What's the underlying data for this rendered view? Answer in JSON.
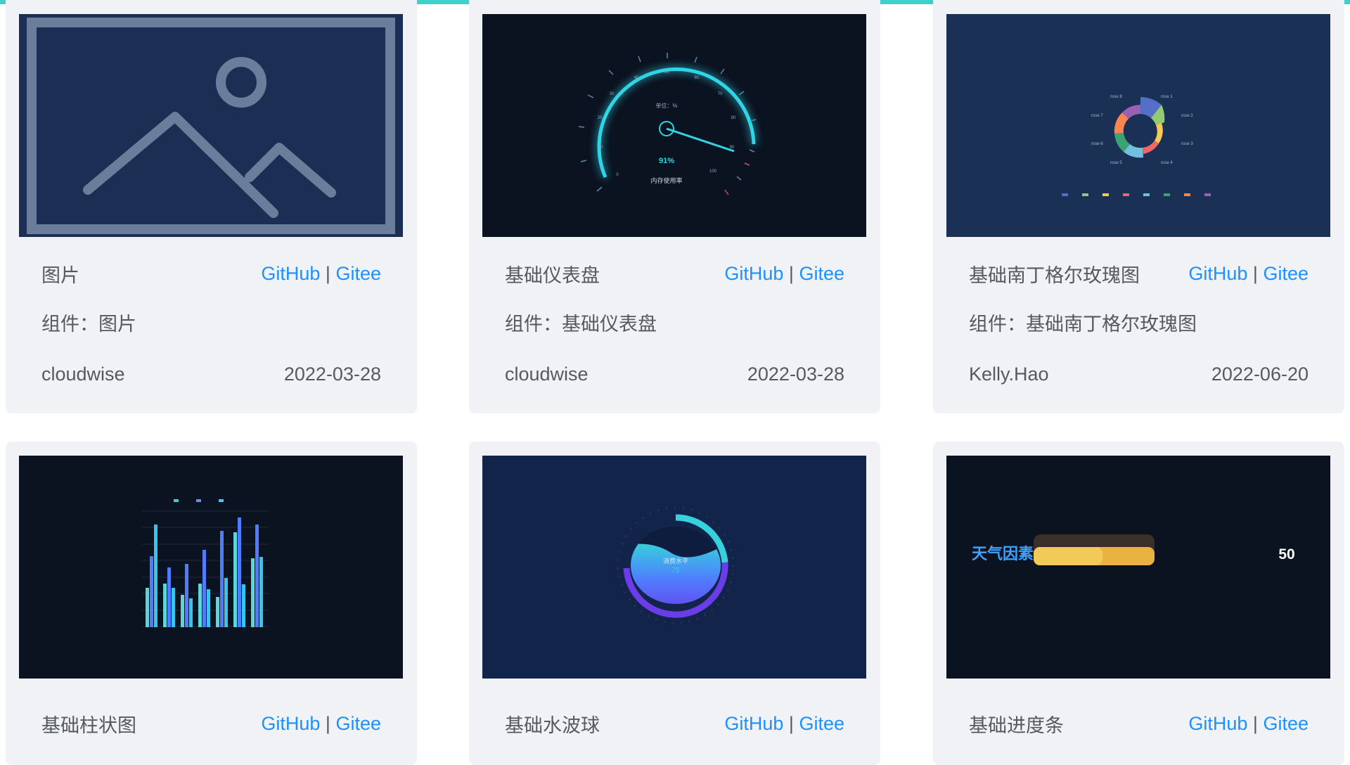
{
  "colors": {
    "accent_bar": "#3fd0c9",
    "link": "#1e90ff",
    "card_bg": "#f0f2f5",
    "text": "#555a60"
  },
  "cards": [
    {
      "title": "图片",
      "github": "GitHub",
      "sep": "|",
      "gitee": "Gitee",
      "component": "组件：图片",
      "author": "cloudwise",
      "date": "2022-03-28",
      "thumb_icon": "image-placeholder-icon"
    },
    {
      "title": "基础仪表盘",
      "github": "GitHub",
      "sep": "|",
      "gitee": "Gitee",
      "component": "组件：基础仪表盘",
      "author": "cloudwise",
      "date": "2022-03-28",
      "thumb": {
        "unit": "单位：%",
        "value": "91%",
        "label": "内存使用率",
        "ticks": [
          "0",
          "10",
          "20",
          "30",
          "40",
          "50",
          "60",
          "70",
          "80",
          "90",
          "100"
        ]
      }
    },
    {
      "title": "基础南丁格尔玫瑰图",
      "github": "GitHub",
      "sep": "|",
      "gitee": "Gitee",
      "component": "组件：基础南丁格尔玫瑰图",
      "author": "Kelly.Hao",
      "date": "2022-06-20",
      "thumb": {
        "labels": [
          "rose 1",
          "rose 2",
          "rose 3",
          "rose 4",
          "rose 5",
          "rose 6",
          "rose 7",
          "rose 8"
        ]
      }
    },
    {
      "title": "基础柱状图",
      "github": "GitHub",
      "sep": "|",
      "gitee": "Gitee"
    },
    {
      "title": "基础水波球",
      "github": "GitHub",
      "sep": "|",
      "gitee": "Gitee",
      "thumb": {
        "label": "消费水平",
        "value": "75"
      }
    },
    {
      "title": "基础进度条",
      "github": "GitHub",
      "sep": "|",
      "gitee": "Gitee",
      "thumb": {
        "label": "天气因素",
        "value": "50"
      }
    }
  ]
}
